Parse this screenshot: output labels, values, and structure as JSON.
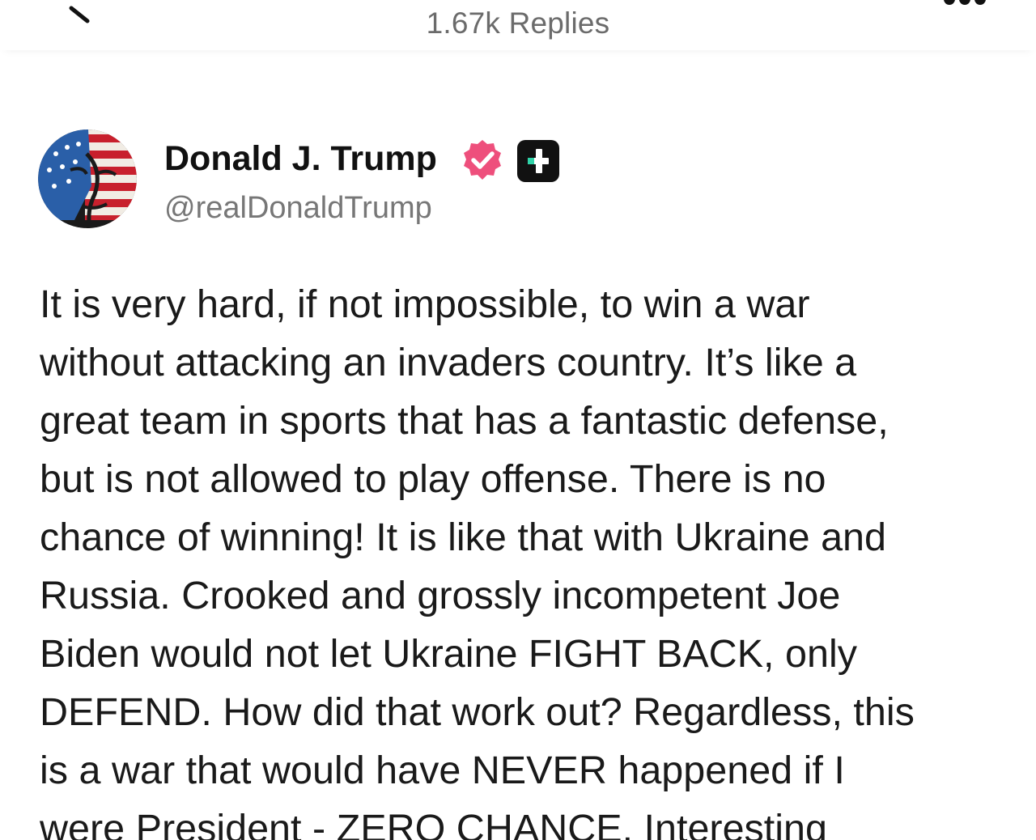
{
  "header": {
    "replies_label": "1.67k Replies"
  },
  "icons": {
    "back": "back-chevron-icon",
    "more": "more-dots-icon",
    "verified": "verified-badge-icon",
    "plus": "plus-badge-icon"
  },
  "colors": {
    "verified": "#ee4f7c",
    "plus_badge_bg": "#111111",
    "plus_badge_accent": "#2fd3a8",
    "handle": "#777777",
    "title": "#6b6b6b"
  },
  "post": {
    "author_name": "Donald J. Trump",
    "author_handle": "@realDonaldTrump",
    "lines": [
      "It is very hard, if not impossible, to win a war",
      "without attacking an invaders country. It’s like a",
      "great team in sports that has a fantastic defense,",
      "but is not allowed to play offense. There is no",
      "chance of winning! It is like that with Ukraine and",
      "Russia. Crooked and grossly incompetent Joe",
      "Biden would not let Ukraine FIGHT BACK, only",
      "DEFEND. How did that work out? Regardless, this",
      "is a war that would have NEVER happened if I",
      "were President - ZERO CHANCE. Interesting"
    ]
  }
}
